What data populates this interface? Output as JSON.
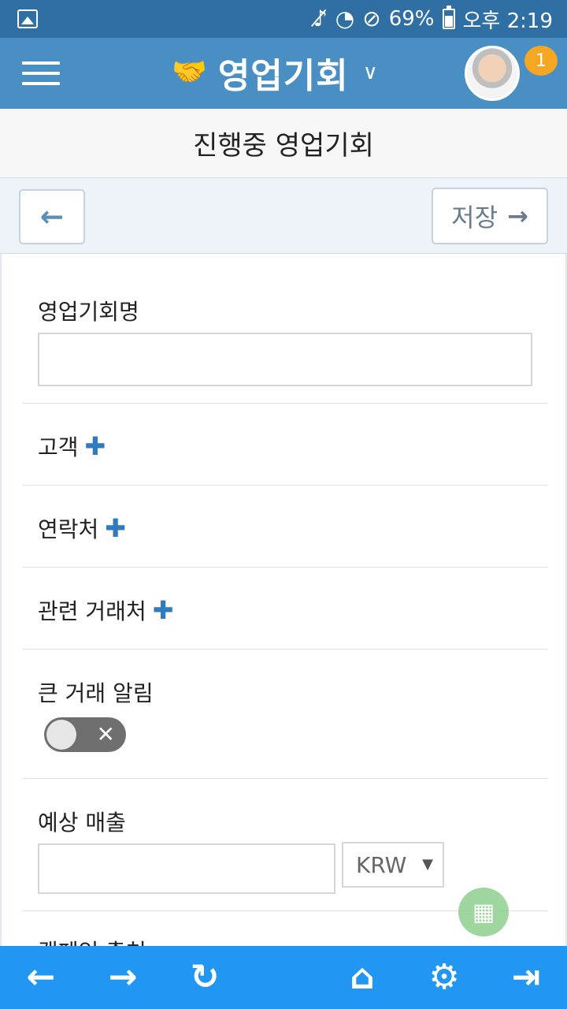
{
  "status_bar": {
    "battery": "69%",
    "time": "오후 2:19",
    "icons": [
      "gallery-icon",
      "vibrate-mute-icon",
      "wifi-icon",
      "do-not-disturb-icon",
      "battery-icon"
    ]
  },
  "header": {
    "title": "영업기회",
    "logo_icon": "handshake-icon",
    "notification_count": "1"
  },
  "page": {
    "title": "진행중 영업기회"
  },
  "actions": {
    "save_label": "저장"
  },
  "form": {
    "name_label": "영업기회명",
    "name_value": "",
    "customer_label": "고객",
    "contact_label": "연락처",
    "related_account_label": "관련 거래처",
    "big_deal_label": "큰 거래 알림",
    "big_deal_enabled": false,
    "expected_revenue_label": "예상 매출",
    "expected_revenue_value": "",
    "currency_selected": "KRW",
    "campaign_label": "캠페인 출처"
  },
  "bottom_nav": {
    "items": [
      "back-icon",
      "forward-icon",
      "refresh-icon",
      "home-icon",
      "settings-icon",
      "logout-icon"
    ]
  }
}
